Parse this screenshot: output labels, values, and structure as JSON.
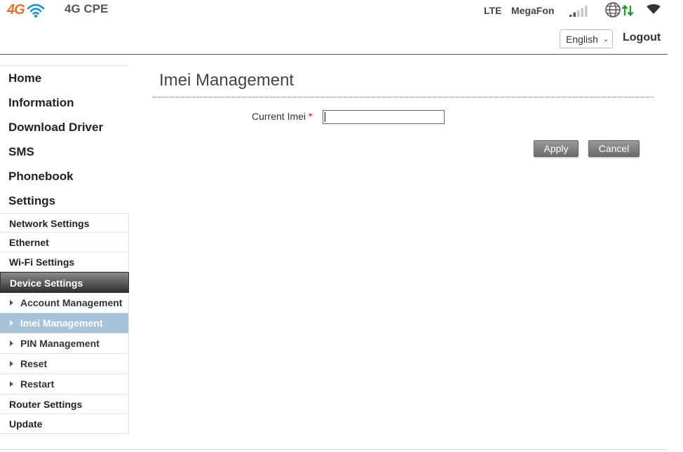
{
  "header": {
    "logo_text": "4G",
    "product_name": "4G CPE",
    "network_type": "LTE",
    "operator": "MegaFon",
    "signal_bars": 2,
    "signal_max": 5,
    "language": "English",
    "logout_label": "Logout"
  },
  "sidebar": {
    "main_items": [
      "Home",
      "Information",
      "Download Driver",
      "SMS",
      "Phonebook",
      "Settings"
    ],
    "settings_items": [
      {
        "label": "Network Settings"
      },
      {
        "label": "Ethernet"
      },
      {
        "label": "Wi-Fi Settings"
      },
      {
        "label": "Device Settings"
      }
    ],
    "device_items": [
      {
        "label": "Account Management"
      },
      {
        "label": "Imei Management"
      },
      {
        "label": "PIN Management"
      },
      {
        "label": "Reset"
      },
      {
        "label": "Restart"
      }
    ],
    "tail_items": [
      {
        "label": "Router Settings"
      },
      {
        "label": "Update"
      }
    ]
  },
  "main": {
    "title": "Imei Management",
    "field_label": "Current Imei",
    "required_mark": "*",
    "imei_value": "",
    "apply_label": "Apply",
    "cancel_label": "Cancel"
  },
  "colors": {
    "logo_orange": "#e8712a",
    "wifi_blue": "#1a8fd8",
    "selected_bg": "#a6c3d9",
    "updown_green": "#1a9a2a"
  }
}
